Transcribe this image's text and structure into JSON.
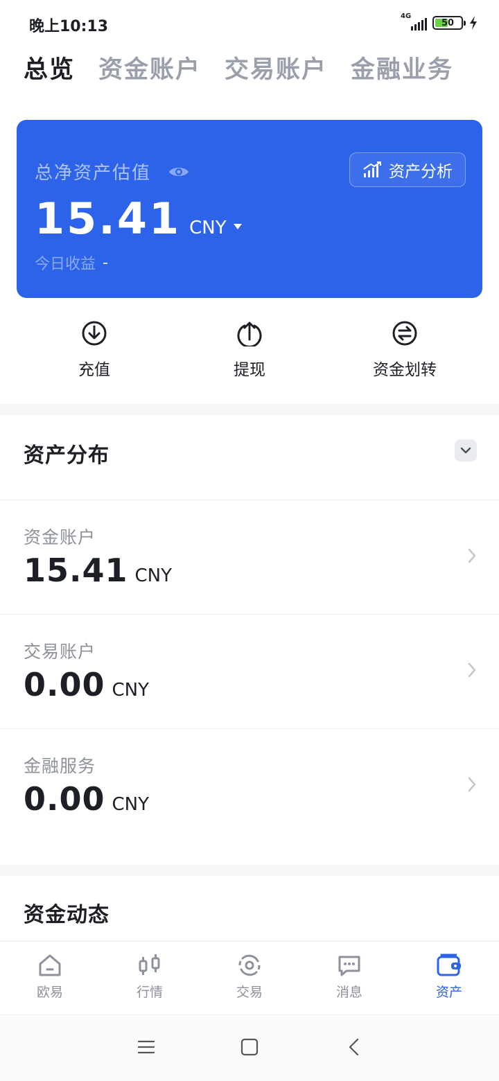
{
  "status_bar": {
    "time": "晚上10:13",
    "network": "4G",
    "battery": "50"
  },
  "top_tabs": [
    {
      "label": "总览",
      "active": true
    },
    {
      "label": "资金账户",
      "active": false
    },
    {
      "label": "交易账户",
      "active": false
    },
    {
      "label": "金融业务",
      "active": false
    }
  ],
  "asset_card": {
    "title": "总净资产估值",
    "amount": "15.41",
    "currency": "CNY",
    "analysis_label": "资产分析",
    "today_label": "今日收益",
    "today_value": "-",
    "background_color": "#2c63e8"
  },
  "actions": [
    {
      "label": "充值",
      "icon": "deposit-icon"
    },
    {
      "label": "提现",
      "icon": "withdraw-icon"
    },
    {
      "label": "资金划转",
      "icon": "transfer-icon"
    }
  ],
  "distribution": {
    "title": "资产分布",
    "accounts": [
      {
        "name": "资金账户",
        "amount": "15.41",
        "currency": "CNY"
      },
      {
        "name": "交易账户",
        "amount": "0.00",
        "currency": "CNY"
      },
      {
        "name": "金融服务",
        "amount": "0.00",
        "currency": "CNY"
      }
    ]
  },
  "fund_activity": {
    "title": "资金动态"
  },
  "bottom_nav": [
    {
      "label": "欧易",
      "icon": "home-icon",
      "active": false
    },
    {
      "label": "行情",
      "icon": "candlestick-icon",
      "active": false
    },
    {
      "label": "交易",
      "icon": "trade-icon",
      "active": false
    },
    {
      "label": "消息",
      "icon": "message-icon",
      "active": false
    },
    {
      "label": "资产",
      "icon": "wallet-icon",
      "active": true
    }
  ],
  "colors": {
    "accent": "#2c63e8",
    "text_primary": "#1c1f26",
    "text_secondary": "#8c919b"
  }
}
